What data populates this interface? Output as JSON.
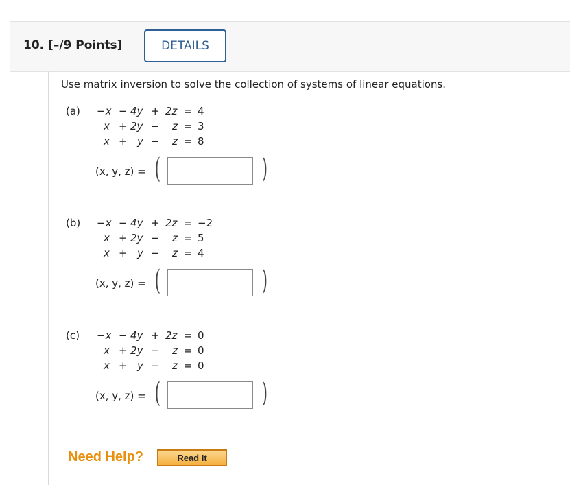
{
  "question": {
    "title": "10.  [–/9 Points]",
    "details_label": "DETAILS",
    "prompt": "Use matrix inversion to solve the collection of systems of linear equations."
  },
  "parts": [
    {
      "label": "(a)",
      "rows": [
        {
          "a": "−x",
          "o1": "−",
          "b": "4y",
          "o2": "+",
          "c": "2z",
          "rhs": "4"
        },
        {
          "a": "x",
          "o1": "+",
          "b": "2y",
          "o2": "−",
          "c": "z",
          "rhs": "3"
        },
        {
          "a": "x",
          "o1": "+",
          "b": "y",
          "o2": "−",
          "c": "z",
          "rhs": "8"
        }
      ],
      "tuple_label": "(x, y, z) =",
      "answer": ""
    },
    {
      "label": "(b)",
      "rows": [
        {
          "a": "−x",
          "o1": "−",
          "b": "4y",
          "o2": "+",
          "c": "2z",
          "rhs": "−2"
        },
        {
          "a": "x",
          "o1": "+",
          "b": "2y",
          "o2": "−",
          "c": "z",
          "rhs": "5"
        },
        {
          "a": "x",
          "o1": "+",
          "b": "y",
          "o2": "−",
          "c": "z",
          "rhs": "4"
        }
      ],
      "tuple_label": "(x, y, z) =",
      "answer": ""
    },
    {
      "label": "(c)",
      "rows": [
        {
          "a": "−x",
          "o1": "−",
          "b": "4y",
          "o2": "+",
          "c": "2z",
          "rhs": "0"
        },
        {
          "a": "x",
          "o1": "+",
          "b": "2y",
          "o2": "−",
          "c": "z",
          "rhs": "0"
        },
        {
          "a": "x",
          "o1": "+",
          "b": "y",
          "o2": "−",
          "c": "z",
          "rhs": "0"
        }
      ],
      "tuple_label": "(x, y, z) =",
      "answer": ""
    }
  ],
  "help": {
    "label": "Need Help?",
    "read_it_label": "Read It"
  },
  "colors": {
    "details_border": "#2e5f95",
    "help_text": "#e8900e",
    "read_it_bg": "#f5b03f"
  }
}
